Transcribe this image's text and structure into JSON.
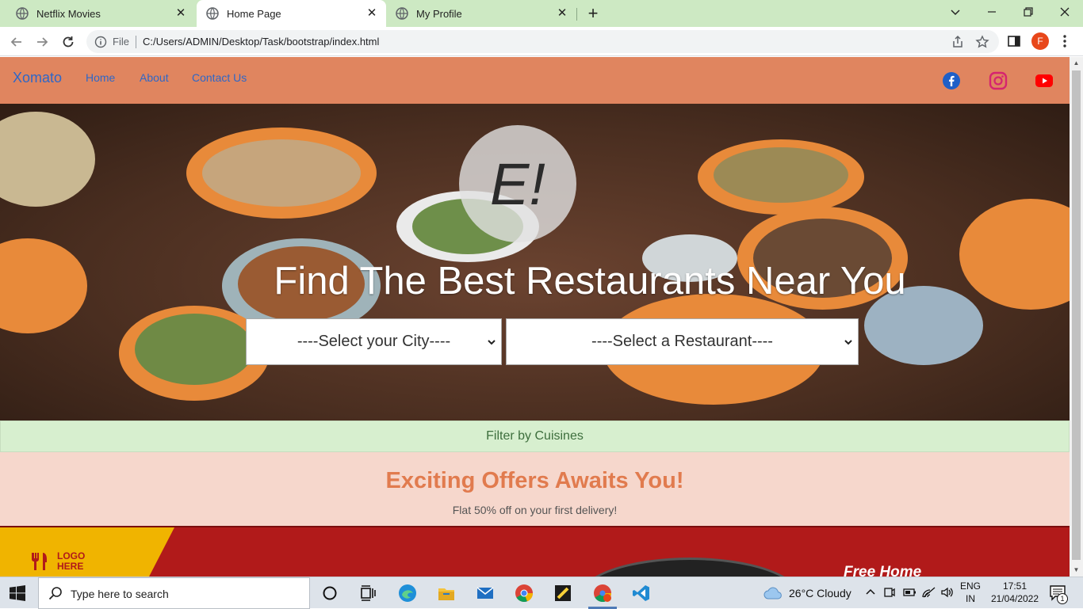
{
  "browser": {
    "tabs": [
      {
        "title": "Netflix Movies",
        "active": false
      },
      {
        "title": "Home Page",
        "active": true
      },
      {
        "title": "My Profile",
        "active": false
      }
    ],
    "address": {
      "scheme_label": "File",
      "url": "C:/Users/ADMIN/Desktop/Task/bootstrap/index.html"
    },
    "profile_initial": "F"
  },
  "site": {
    "brand": "Xomato",
    "nav": [
      "Home",
      "About",
      "Contact Us"
    ],
    "social": [
      "facebook-icon",
      "instagram-icon",
      "youtube-icon"
    ],
    "hero": {
      "logo_text": "E!",
      "headline": "Find The Best Restaurants Near You",
      "city_select": "----Select your City----",
      "restaurant_select": "----Select a Restaurant----"
    },
    "filter_label": "Filter by Cuisines",
    "offers": {
      "title": "Exciting Offers Awaits You!",
      "subtitle": "Flat 50% off on your first delivery!"
    },
    "banner": {
      "logo_text_line1": "LOGO",
      "logo_text_line2": "HERE",
      "tagline": "Free Home"
    },
    "colors": {
      "navbar": "#e0855f",
      "link": "#2e67c8",
      "filter_bg": "#d7efcf",
      "offers_bg": "#f6d7cc",
      "offers_title": "#e17b4e"
    }
  },
  "taskbar": {
    "search_placeholder": "Type here to search",
    "weather": "26°C  Cloudy",
    "lang_line1": "ENG",
    "lang_line2": "IN",
    "time": "17:51",
    "date": "21/04/2022",
    "notification_count": "1"
  }
}
